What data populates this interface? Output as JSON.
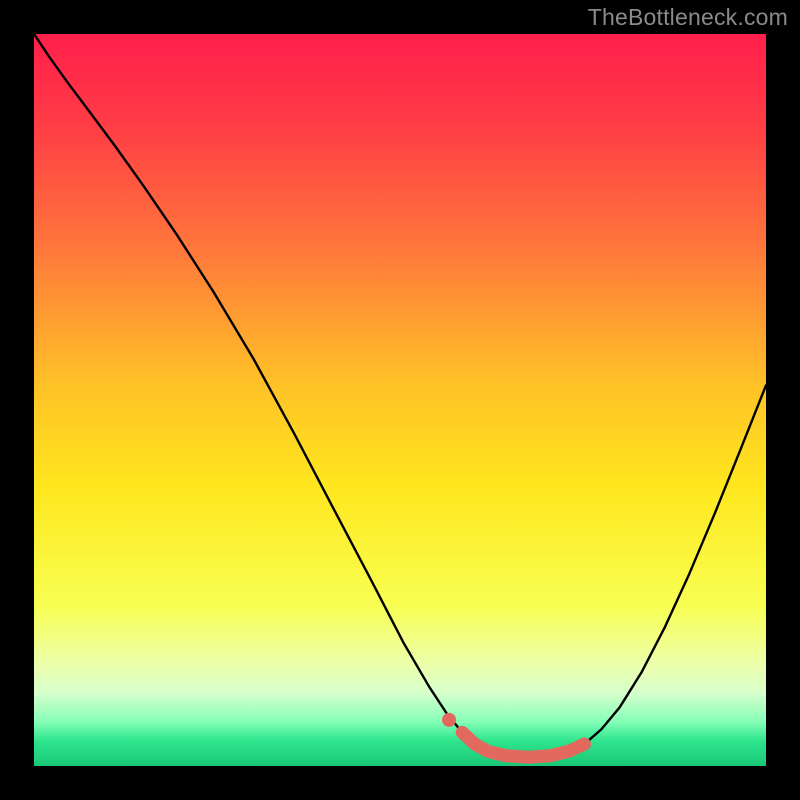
{
  "watermark": "TheBottleneck.com",
  "chart_data": {
    "type": "line",
    "title": "",
    "xlabel": "",
    "ylabel": "",
    "xlim": [
      0,
      1
    ],
    "ylim": [
      0,
      1
    ],
    "gradient_stops": [
      {
        "offset": 0.0,
        "color": "#ff1f4b"
      },
      {
        "offset": 0.12,
        "color": "#ff3b46"
      },
      {
        "offset": 0.3,
        "color": "#ff7a3a"
      },
      {
        "offset": 0.48,
        "color": "#ffc227"
      },
      {
        "offset": 0.62,
        "color": "#ffe71e"
      },
      {
        "offset": 0.78,
        "color": "#f8ff52"
      },
      {
        "offset": 0.86,
        "color": "#ecffa9"
      },
      {
        "offset": 0.9,
        "color": "#d7ffcc"
      },
      {
        "offset": 0.94,
        "color": "#84ffb7"
      },
      {
        "offset": 0.965,
        "color": "#2fe58d"
      },
      {
        "offset": 1.0,
        "color": "#19c776"
      }
    ],
    "series": [
      {
        "name": "bottleneck-curve",
        "color": "#000000",
        "width": 2.4,
        "points": [
          [
            0.0,
            1.0
          ],
          [
            0.02,
            0.97
          ],
          [
            0.045,
            0.935
          ],
          [
            0.075,
            0.895
          ],
          [
            0.11,
            0.848
          ],
          [
            0.15,
            0.792
          ],
          [
            0.195,
            0.726
          ],
          [
            0.245,
            0.648
          ],
          [
            0.3,
            0.556
          ],
          [
            0.355,
            0.455
          ],
          [
            0.41,
            0.35
          ],
          [
            0.46,
            0.255
          ],
          [
            0.505,
            0.168
          ],
          [
            0.54,
            0.108
          ],
          [
            0.565,
            0.07
          ],
          [
            0.585,
            0.046
          ],
          [
            0.602,
            0.03
          ],
          [
            0.62,
            0.02
          ],
          [
            0.645,
            0.014
          ],
          [
            0.675,
            0.012
          ],
          [
            0.705,
            0.014
          ],
          [
            0.73,
            0.02
          ],
          [
            0.752,
            0.03
          ],
          [
            0.775,
            0.05
          ],
          [
            0.8,
            0.08
          ],
          [
            0.83,
            0.128
          ],
          [
            0.862,
            0.19
          ],
          [
            0.895,
            0.262
          ],
          [
            0.93,
            0.345
          ],
          [
            0.965,
            0.432
          ],
          [
            1.0,
            0.52
          ]
        ]
      },
      {
        "name": "optimal-range-marker",
        "color": "#e3695f",
        "width": 13,
        "linecap": "round",
        "points": [
          [
            0.585,
            0.046
          ],
          [
            0.602,
            0.03
          ],
          [
            0.62,
            0.02
          ],
          [
            0.645,
            0.014
          ],
          [
            0.675,
            0.012
          ],
          [
            0.705,
            0.014
          ],
          [
            0.73,
            0.02
          ],
          [
            0.752,
            0.03
          ]
        ],
        "dot": {
          "x": 0.567,
          "y": 0.063,
          "r": 7
        }
      }
    ]
  }
}
